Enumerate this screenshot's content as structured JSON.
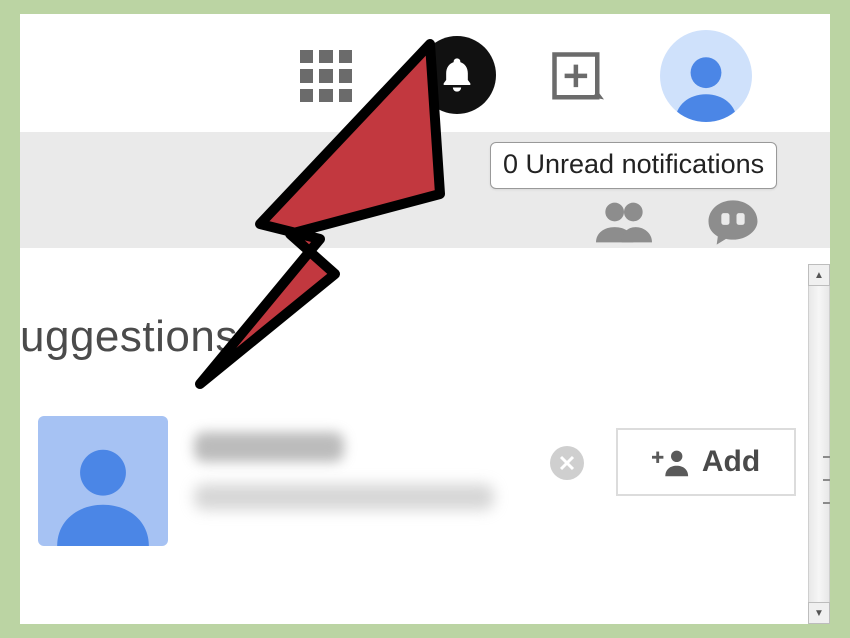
{
  "header": {
    "icons": {
      "apps": "apps-icon",
      "notifications": "bell-icon",
      "share": "share-post-icon",
      "profile": "profile-avatar"
    }
  },
  "tooltip": {
    "text": "0 Unread notifications"
  },
  "subbar": {
    "icons": {
      "find_people": "people-icon",
      "hangouts": "hangouts-icon"
    }
  },
  "suggestions": {
    "title": "uggestions",
    "item": {
      "name_redacted": true,
      "subtitle_redacted": true,
      "add_label": "Add"
    }
  },
  "annotation": {
    "cursor_color": "#c2383f",
    "cursor_outline": "#000000",
    "points_to": "notifications"
  }
}
